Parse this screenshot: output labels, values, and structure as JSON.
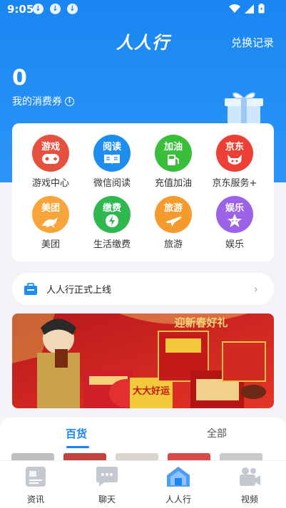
{
  "status_bar": {
    "time": "9:05",
    "download_icons": [
      "download-icon",
      "download-icon",
      "download-icon"
    ],
    "icons": [
      "wifi-icon",
      "signal-icon",
      "battery-icon"
    ]
  },
  "header": {
    "title": "人人行",
    "record_link": "兑换记录"
  },
  "coupon": {
    "count": "0",
    "label": "我的消费券",
    "info_icon": "ⓘ"
  },
  "services": [
    {
      "badge": "游戏",
      "label": "游戏中心",
      "color": "#e5503f",
      "icon": "gamepad-icon"
    },
    {
      "badge": "阅读",
      "label": "微信阅读",
      "color": "#1d8ef0",
      "icon": "book-icon"
    },
    {
      "badge": "加油",
      "label": "充值加油",
      "color": "#3bbf3b",
      "icon": "fuel-icon"
    },
    {
      "badge": "京东",
      "label": "京东服务+",
      "color": "#ec4036",
      "icon": "jd-dog-icon"
    },
    {
      "badge": "美团",
      "label": "美团",
      "color": "#f7a53a",
      "icon": "kangaroo-icon"
    },
    {
      "badge": "缴费",
      "label": "生活缴费",
      "color": "#2fb84f",
      "icon": "lightning-icon"
    },
    {
      "badge": "旅游",
      "label": "旅游",
      "color": "#f59a2d",
      "icon": "plane-icon"
    },
    {
      "badge": "娱乐",
      "label": "娱乐",
      "color": "#9b63e8",
      "icon": "star-icon"
    }
  ],
  "notice": {
    "text": "人人行正式上线"
  },
  "banner": {
    "alt": "promo-banner"
  },
  "tabs": [
    {
      "label": "百货",
      "active": true
    },
    {
      "label": "全部",
      "active": false
    }
  ],
  "bottom_nav": [
    {
      "label": "资讯",
      "icon": "news-icon",
      "active": false
    },
    {
      "label": "聊天",
      "icon": "chat-icon",
      "active": false
    },
    {
      "label": "人人行",
      "icon": "home-icon",
      "active": true
    },
    {
      "label": "视频",
      "icon": "video-icon",
      "active": false
    }
  ],
  "colors": {
    "primary": "#1a86f2",
    "background": "#f2f4f7"
  }
}
